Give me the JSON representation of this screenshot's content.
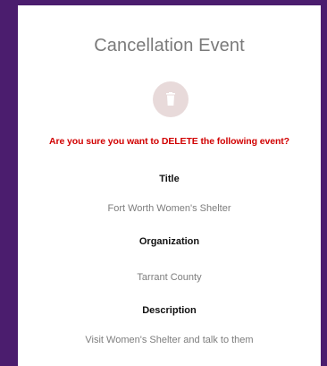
{
  "modal": {
    "title": "Cancellation Event",
    "icon": "trash-icon",
    "warning": "Are you sure you want to DELETE the following event?",
    "fields": {
      "title_label": "Title",
      "title_value": "Fort Worth Women's Shelter",
      "organization_label": "Organization",
      "organization_value": "Tarrant County",
      "description_label": "Description",
      "description_value": "Visit Women's Shelter and talk to them"
    }
  },
  "colors": {
    "frame": "#4b1d6e",
    "warning": "#d10000",
    "icon_circle": "#e8dada",
    "muted_text": "#7d7d7d"
  }
}
